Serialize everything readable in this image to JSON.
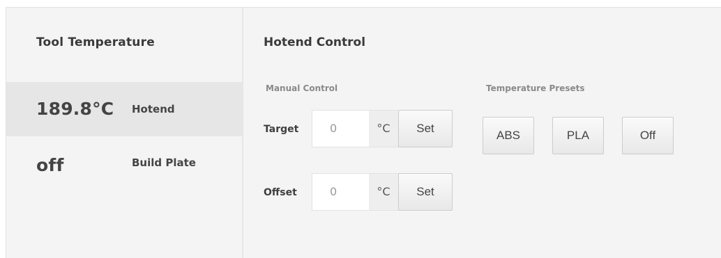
{
  "tool_temperature": {
    "title": "Tool Temperature",
    "rows": [
      {
        "value": "189.8°C",
        "label": "Hotend"
      },
      {
        "value": "off",
        "label": "Build Plate"
      }
    ]
  },
  "hotend_control": {
    "title": "Hotend Control",
    "manual_control": {
      "title": "Manual Control",
      "target": {
        "label": "Target",
        "value": "0",
        "unit": "°C",
        "button": "Set"
      },
      "offset": {
        "label": "Offset",
        "value": "0",
        "unit": "°C",
        "button": "Set"
      }
    },
    "presets": {
      "title": "Temperature Presets",
      "buttons": [
        "ABS",
        "PLA",
        "Off"
      ]
    }
  }
}
